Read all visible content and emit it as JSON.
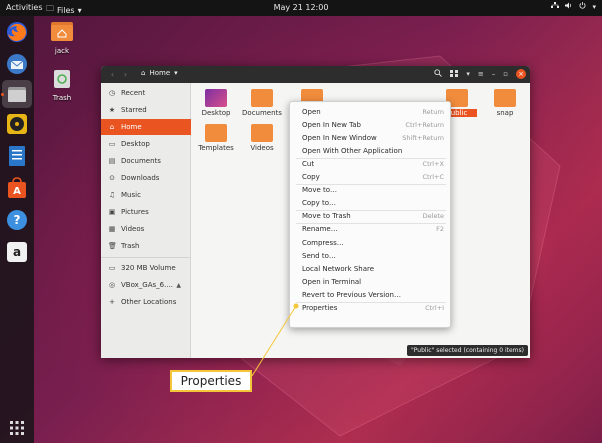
{
  "topbar": {
    "activities": "Activities",
    "app_menu": "Files",
    "clock": "May 21 12:00"
  },
  "desktop": {
    "home_icon_label": "jack",
    "trash_icon_label": "Trash"
  },
  "dock": {
    "items": [
      "firefox-icon",
      "thunderbird-icon",
      "files-icon",
      "rhythmbox-icon",
      "writer-icon",
      "software-icon",
      "help-icon",
      "amazon-icon",
      "show-apps-icon"
    ]
  },
  "window": {
    "path_label": "Home",
    "sidebar": {
      "recent": "Recent",
      "starred": "Starred",
      "home": "Home",
      "desktop": "Desktop",
      "documents": "Documents",
      "downloads": "Downloads",
      "music": "Music",
      "pictures": "Pictures",
      "videos": "Videos",
      "trash": "Trash",
      "volume": "320 MB Volume",
      "vbox": "VBox_GAs_6....",
      "other": "Other Locations"
    },
    "folders": {
      "desktop": "Desktop",
      "documents": "Documents",
      "public": "Public",
      "snap": "snap",
      "templates": "Templates",
      "videos": "Videos"
    },
    "status": "\"Public\" selected (containing 0 items)"
  },
  "context_menu": {
    "open": "Open",
    "open_sc": "Return",
    "open_tab": "Open In New Tab",
    "open_tab_sc": "Ctrl+Return",
    "open_window": "Open In New Window",
    "open_window_sc": "Shift+Return",
    "open_other": "Open With Other Application",
    "cut": "Cut",
    "cut_sc": "Ctrl+X",
    "copy": "Copy",
    "copy_sc": "Ctrl+C",
    "move_to": "Move to…",
    "copy_to": "Copy to…",
    "move_trash": "Move to Trash",
    "move_trash_sc": "Delete",
    "rename": "Rename…",
    "rename_sc": "F2",
    "compress": "Compress…",
    "send_to": "Send to…",
    "local_share": "Local Network Share",
    "open_terminal": "Open in Terminal",
    "revert": "Revert to Previous Version…",
    "properties": "Properties",
    "properties_sc": "Ctrl+I"
  },
  "callout": {
    "label": "Properties"
  },
  "colors": {
    "accent": "#e95420",
    "callout_border": "#f4c63a"
  }
}
